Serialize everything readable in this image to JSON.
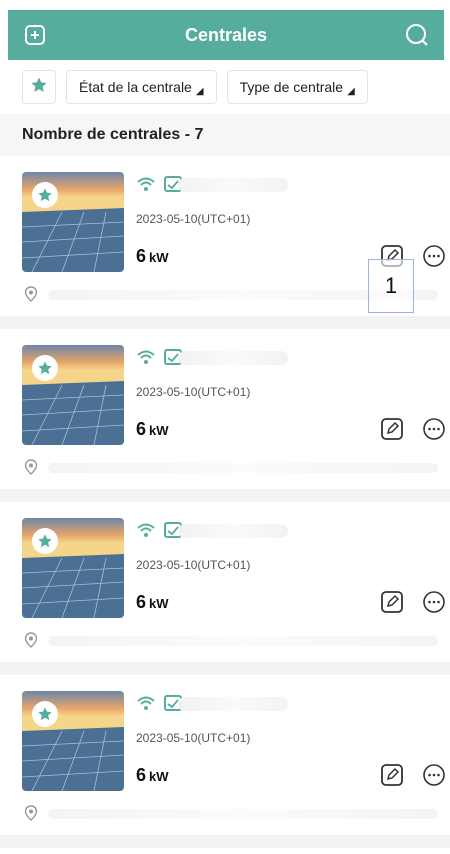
{
  "header": {
    "title": "Centrales",
    "left_icon": "add-square-icon",
    "right_icon": "search-icon",
    "color": "#56ad9d"
  },
  "filters": {
    "favorite_icon": "star-icon",
    "plant_status": "État de la centrale",
    "plant_type": "Type de centrale"
  },
  "count_label": "Nombre de centrales - 7",
  "plants": [
    {
      "date": "2023-05-10(UTC+01)",
      "power_value": "6",
      "power_unit": "kW"
    },
    {
      "date": "2023-05-10(UTC+01)",
      "power_value": "6",
      "power_unit": "kW"
    },
    {
      "date": "2023-05-10(UTC+01)",
      "power_value": "6",
      "power_unit": "kW"
    },
    {
      "date": "2023-05-10(UTC+01)",
      "power_value": "6",
      "power_unit": "kW"
    }
  ],
  "annotation": {
    "label": "1"
  }
}
